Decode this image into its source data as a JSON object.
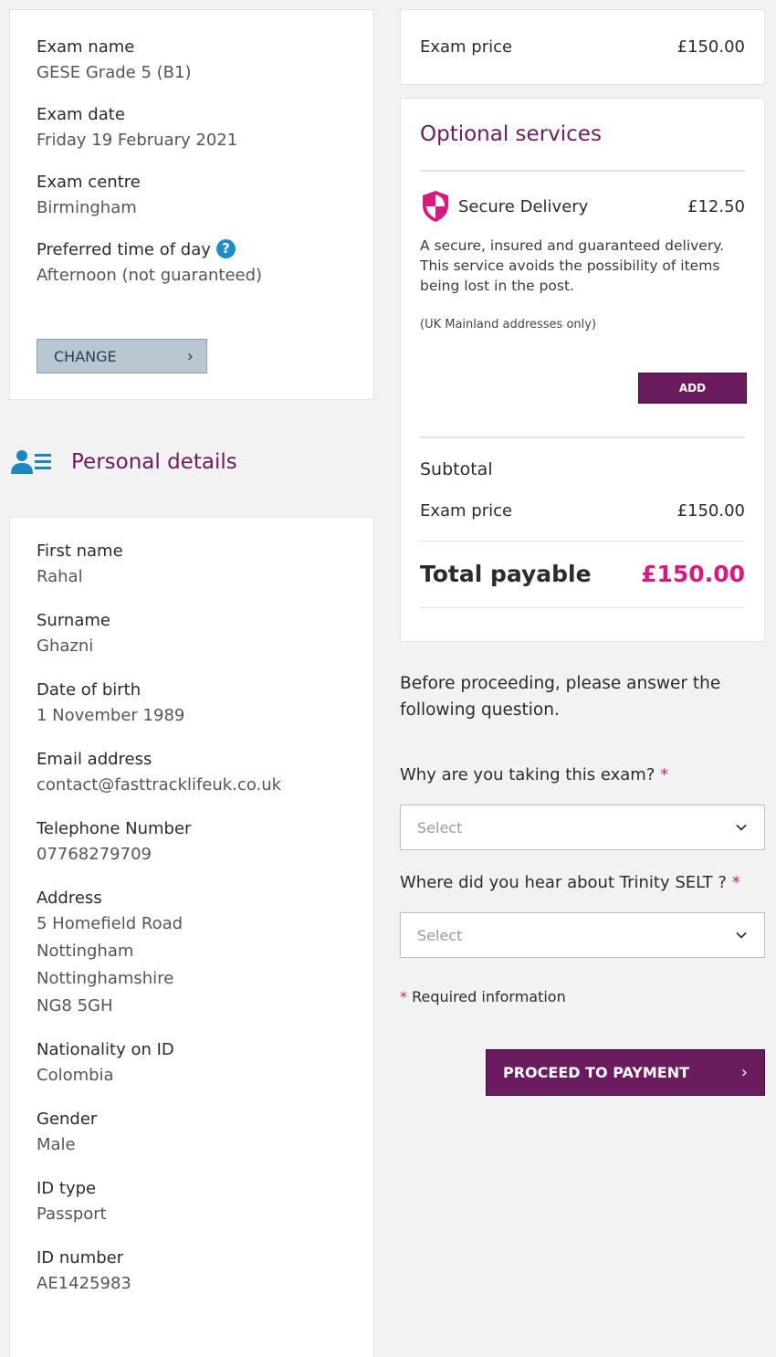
{
  "exam": {
    "fields": [
      {
        "label": "Exam name",
        "value": "GESE Grade 5 (B1)"
      },
      {
        "label": "Exam date",
        "value": "Friday 19 February 2021"
      },
      {
        "label": "Exam centre",
        "value": "Birmingham"
      },
      {
        "label": "Preferred time of day",
        "value": "Afternoon (not guaranteed)"
      }
    ],
    "help_glyph": "?",
    "change_label": "CHANGE",
    "change_chevron": "›"
  },
  "personal": {
    "title": "Personal details",
    "first_name": {
      "label": "First name",
      "value": "Rahal"
    },
    "surname": {
      "label": "Surname",
      "value": "Ghazni"
    },
    "dob": {
      "label": "Date of birth",
      "value": "1 November 1989"
    },
    "email": {
      "label": "Email address",
      "value": "contact@fasttracklifeuk.co.uk"
    },
    "phone": {
      "label": "Telephone Number",
      "value": "07768279709"
    },
    "address": {
      "label": "Address",
      "lines": [
        "5 Homefield Road",
        "Nottingham",
        "Nottinghamshire",
        "NG8 5GH"
      ]
    },
    "nationality": {
      "label": "Nationality on ID",
      "value": "Colombia"
    },
    "gender": {
      "label": "Gender",
      "value": "Male"
    },
    "id_type": {
      "label": "ID type",
      "value": "Passport"
    },
    "id_number": {
      "label": "ID number",
      "value": "AE1425983"
    }
  },
  "price": {
    "label": "Exam price",
    "value": "£150.00"
  },
  "services": {
    "title": "Optional services",
    "secure_delivery": {
      "name": "Secure Delivery",
      "price": "£12.50",
      "description": "A secure, insured and guaranteed delivery. This service avoids the possibility of items being lost in the post.",
      "note": "(UK Mainland addresses only)",
      "add_label": "ADD"
    },
    "subtotal_label": "Subtotal",
    "sub_price_label": "Exam price",
    "sub_price_value": "£150.00",
    "total_label": "Total payable",
    "total_value": "£150.00"
  },
  "questions": {
    "intro": "Before proceeding, please answer the following question.",
    "q1_label": "Why are you taking this exam?",
    "q2_label": "Where did you hear about Trinity SELT ?",
    "required_mark": "*",
    "select_placeholder": "Select",
    "required_note": "Required information"
  },
  "proceed": {
    "label": "PROCEED TO PAYMENT",
    "chevron": "›"
  },
  "colors": {
    "brand": "#6a1c5f",
    "accent": "#d8197f",
    "help": "#1f8cc6",
    "person_icon": "#1a86c2"
  }
}
